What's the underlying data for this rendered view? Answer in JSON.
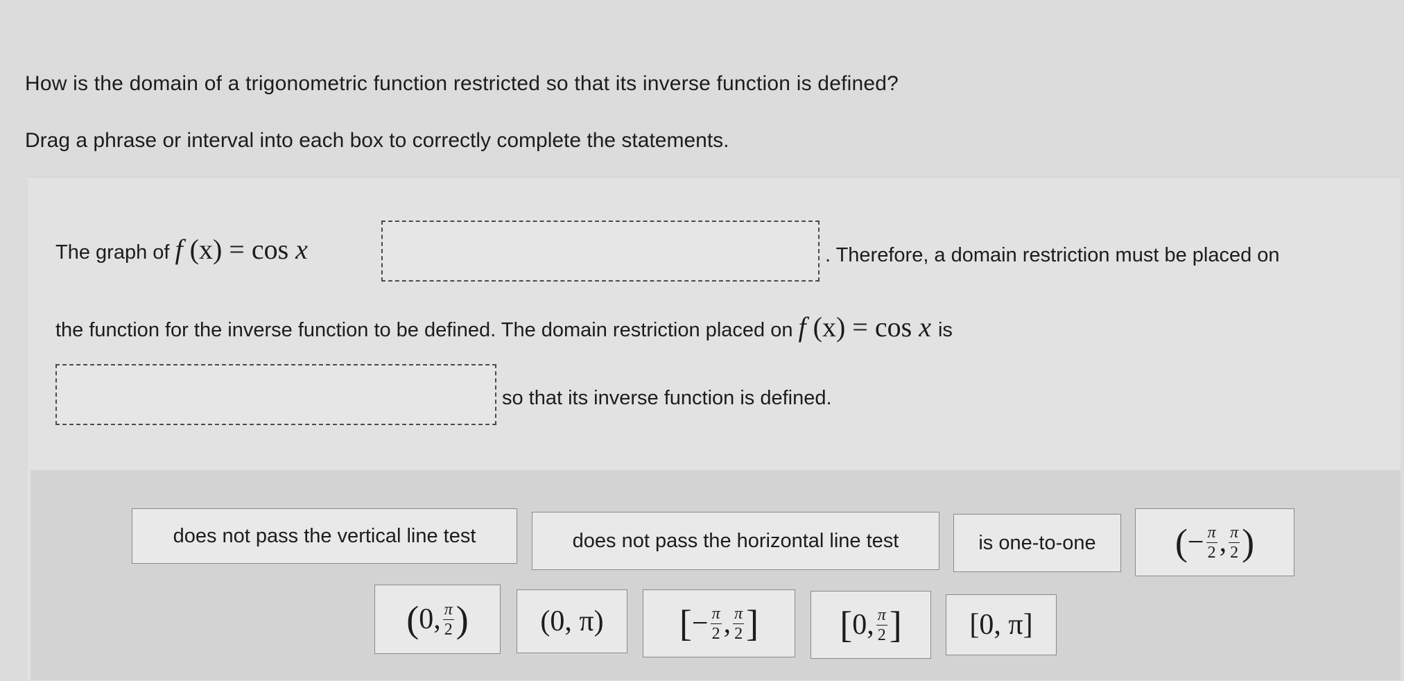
{
  "question": "How is the domain of a trigonometric function restricted so that its inverse function is defined?",
  "instruction": "Drag a phrase or interval into each box to correctly complete the statements.",
  "statement": {
    "part1_prefix": "The graph of",
    "function_expr": {
      "f": "f",
      "x": "(x)",
      "eq": "=",
      "cos": "cos",
      "var": "x"
    },
    "part1_suffix": ". Therefore, a domain restriction must be placed on",
    "part2": "the function for the inverse function to be defined. The domain restriction placed on",
    "part2_suffix": "is",
    "part3": "so that its inverse function is defined."
  },
  "tiles": {
    "vertical": "does not pass the vertical line test",
    "horizontal": "does not pass the horizontal line test",
    "one_to_one": "is one-to-one",
    "open_neg_pi2_pi2": {
      "open": "(",
      "minus": "−",
      "num": "π",
      "den": "2",
      "comma": ",",
      "close": ")"
    },
    "open_0_pi2": {
      "open": "(",
      "zero": "0,",
      "num": "π",
      "den": "2",
      "close": ")"
    },
    "open_0_pi": "(0, π)",
    "closed_neg_pi2_pi2": {
      "open": "[",
      "minus": "−",
      "num": "π",
      "den": "2",
      "comma": ",",
      "close": "]"
    },
    "closed_0_pi2": {
      "open": "[",
      "zero": "0,",
      "num": "π",
      "den": "2",
      "close": "]"
    },
    "closed_0_pi": "[0, π]"
  }
}
